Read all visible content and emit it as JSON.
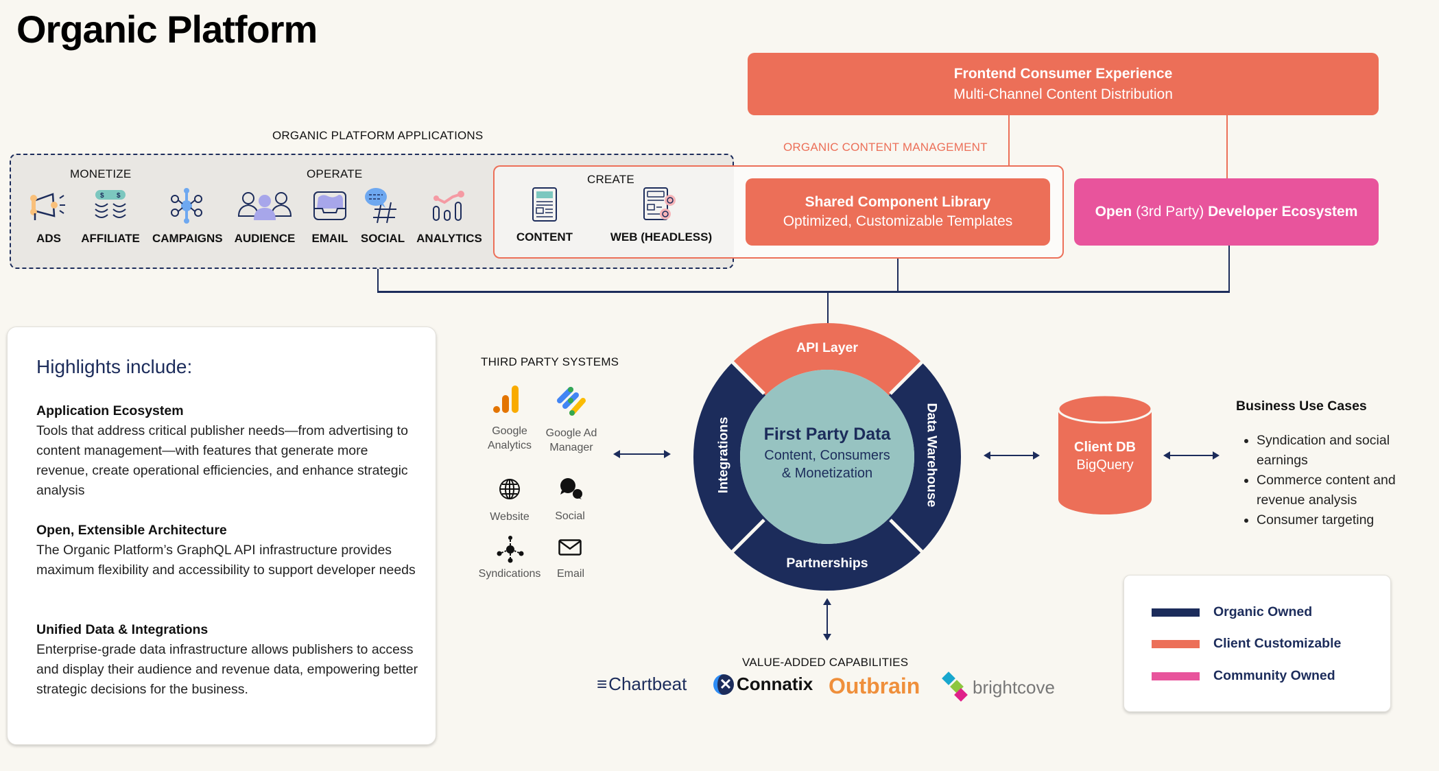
{
  "title": "Organic Platform",
  "frontend": {
    "title": "Frontend Consumer Experience",
    "subtitle": "Multi-Channel Content Distribution"
  },
  "org_content_mgmt_label": "ORGANIC CONTENT MANAGEMENT",
  "shared_lib": {
    "title": "Shared Component Library",
    "subtitle": "Optimized, Customizable Templates"
  },
  "dev_ecosystem": {
    "bold1": "Open",
    "light": " (3rd Party) ",
    "bold2": "Developer Ecosystem"
  },
  "apps": {
    "heading": "ORGANIC PLATFORM APPLICATIONS",
    "groups": {
      "monetize": "MONETIZE",
      "operate": "OPERATE",
      "create": "CREATE"
    },
    "items": [
      {
        "label": "ADS",
        "icon": "megaphone-icon"
      },
      {
        "label": "AFFILIATE",
        "icon": "coins-icon"
      },
      {
        "label": "CAMPAIGNS",
        "icon": "network-icon"
      },
      {
        "label": "AUDIENCE",
        "icon": "people-icon"
      },
      {
        "label": "EMAIL",
        "icon": "inbox-icon"
      },
      {
        "label": "SOCIAL",
        "icon": "hashtag-chat-icon"
      },
      {
        "label": "ANALYTICS",
        "icon": "bar-analytics-icon"
      },
      {
        "label": "CONTENT",
        "icon": "document-icon"
      },
      {
        "label": "WEB (HEADLESS)",
        "icon": "web-gears-icon"
      }
    ]
  },
  "highlights": {
    "heading": "Highlights include:",
    "sections": [
      {
        "title": "Application Ecosystem",
        "body": "Tools that address critical publisher needs—from advertising to content management—with features that generate more revenue, create operational efficiencies, and enhance strategic analysis"
      },
      {
        "title": "Open, Extensible Architecture",
        "body": "The Organic Platform’s GraphQL API infrastructure provides maximum flexibility and accessibility to support developer needs"
      },
      {
        "title": "Unified Data & Integrations",
        "body": "Enterprise-grade data infrastructure allows publishers to access and display their audience and revenue data, empowering better strategic decisions for the business."
      }
    ]
  },
  "third_party": {
    "heading": "THIRD PARTY SYSTEMS",
    "items": [
      {
        "label": "Google Analytics",
        "icon": "google-analytics-icon"
      },
      {
        "label": "Google Ad Manager",
        "icon": "google-ad-manager-icon"
      },
      {
        "label": "Website",
        "icon": "globe-icon"
      },
      {
        "label": "Social",
        "icon": "chat-bubbles-icon"
      },
      {
        "label": "Syndications",
        "icon": "hub-icon"
      },
      {
        "label": "Email",
        "icon": "envelope-icon"
      }
    ]
  },
  "core": {
    "title": "First Party Data",
    "subtitle1": "Content, Consumers",
    "subtitle2": "& Monetization",
    "segments": {
      "top": "API Layer",
      "left": "Integrations",
      "right": "Data Warehouse",
      "bottom": "Partnerships"
    }
  },
  "client_db": {
    "title": "Client DB",
    "subtitle": "BigQuery"
  },
  "business_use_cases": {
    "heading": "Business Use Cases",
    "items": [
      "Syndication and social earnings",
      "Commerce content and revenue analysis",
      "Consumer targeting"
    ]
  },
  "value_added": {
    "heading": "VALUE-ADDED CAPABILITIES",
    "logos": [
      "Chartbeat",
      "Connatix",
      "Outbrain",
      "brightcove"
    ]
  },
  "legend": [
    {
      "label": "Organic Owned",
      "color": "#1c2c5b"
    },
    {
      "label": "Client Customizable",
      "color": "#ec6f58"
    },
    {
      "label": "Community Owned",
      "color": "#e8549c"
    }
  ],
  "colors": {
    "navy": "#1c2c5b",
    "coral": "#ec6f58",
    "pink": "#e8549c",
    "teal": "#97c3c1",
    "background": "#f9f7f1"
  }
}
